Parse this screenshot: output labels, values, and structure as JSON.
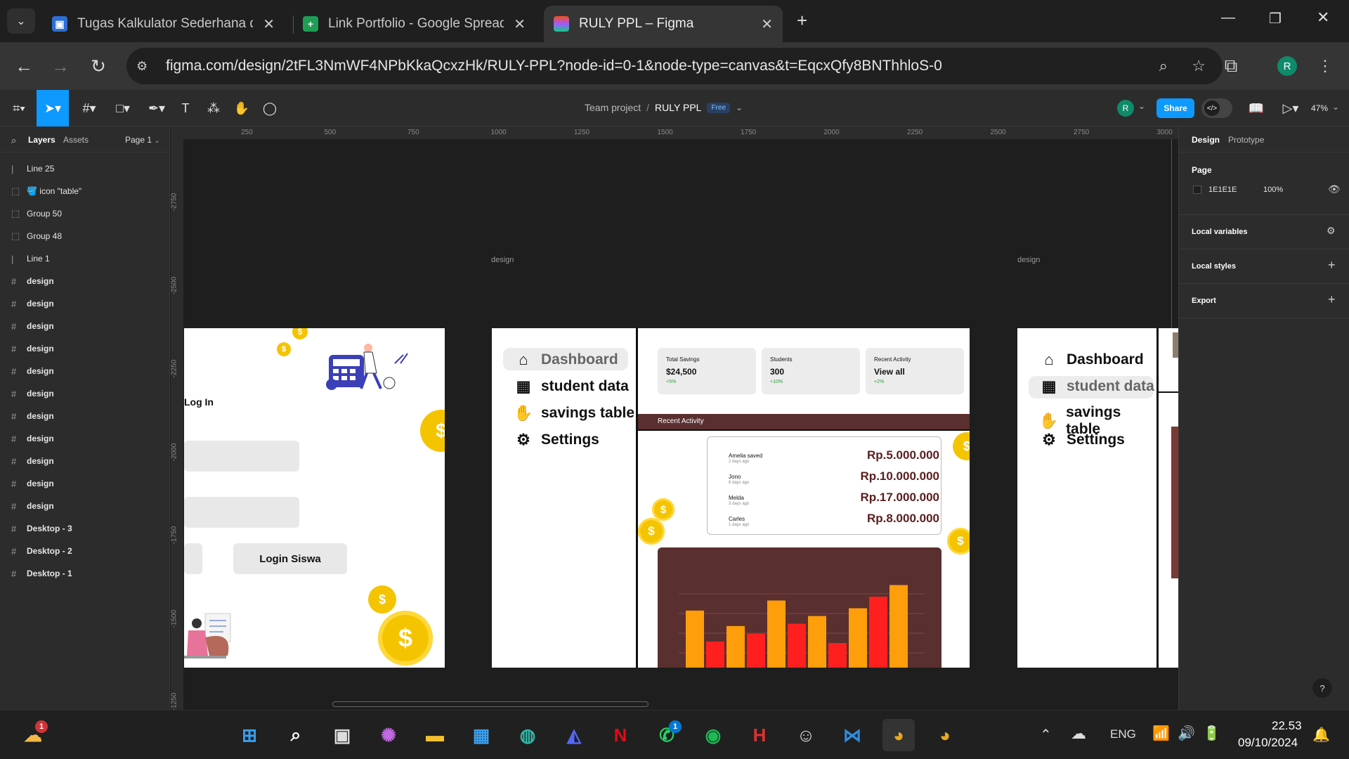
{
  "browser": {
    "tabs": [
      {
        "title": "Tugas Kalkulator Sederhana dengan",
        "active": false
      },
      {
        "title": "Link Portfolio - Google Spreadsheet",
        "active": false
      },
      {
        "title": "RULY PPL – Figma",
        "active": true
      }
    ],
    "url": "figma.com/design/2tFL3NmWF4NPbKkaQcxzHk/RULY-PPL?node-id=0-1&node-type=canvas&t=EqcxQfy8BNThhloS-0",
    "profile_initial": "R"
  },
  "figma_toolbar": {
    "breadcrumb_team": "Team project",
    "breadcrumb_sep": "/",
    "file_name": "RULY PPL",
    "plan_badge": "Free",
    "avatar_initial": "R",
    "share_label": "Share",
    "zoom": "47%"
  },
  "left_panel": {
    "tab_layers": "Layers",
    "tab_assets": "Assets",
    "page_selector": "Page 1",
    "layers": [
      {
        "icon": "line-icon",
        "glyph": "|",
        "name": "Line 25"
      },
      {
        "icon": "group-icon",
        "glyph": "⬚",
        "name": "🪣 icon \"table\""
      },
      {
        "icon": "group-icon",
        "glyph": "⬚",
        "name": "Group 50"
      },
      {
        "icon": "group-icon",
        "glyph": "⬚",
        "name": "Group 48"
      },
      {
        "icon": "line-icon",
        "glyph": "|",
        "name": "Line 1"
      },
      {
        "icon": "frame-icon",
        "glyph": "#",
        "name": "design"
      },
      {
        "icon": "frame-icon",
        "glyph": "#",
        "name": "design"
      },
      {
        "icon": "frame-icon",
        "glyph": "#",
        "name": "design"
      },
      {
        "icon": "frame-icon",
        "glyph": "#",
        "name": "design"
      },
      {
        "icon": "frame-icon",
        "glyph": "#",
        "name": "design"
      },
      {
        "icon": "frame-icon",
        "glyph": "#",
        "name": "design"
      },
      {
        "icon": "frame-icon",
        "glyph": "#",
        "name": "design"
      },
      {
        "icon": "frame-icon",
        "glyph": "#",
        "name": "design"
      },
      {
        "icon": "frame-icon",
        "glyph": "#",
        "name": "design"
      },
      {
        "icon": "frame-icon",
        "glyph": "#",
        "name": "design"
      },
      {
        "icon": "frame-icon",
        "glyph": "#",
        "name": "design"
      },
      {
        "icon": "frame-icon",
        "glyph": "#",
        "name": "Desktop - 3"
      },
      {
        "icon": "frame-icon",
        "glyph": "#",
        "name": "Desktop - 2"
      },
      {
        "icon": "frame-icon",
        "glyph": "#",
        "name": "Desktop - 1"
      }
    ]
  },
  "rulers": {
    "top": [
      "250",
      "500",
      "750",
      "1000",
      "1250",
      "1500",
      "1750",
      "2000",
      "2250",
      "2500",
      "2750",
      "3000"
    ],
    "left": [
      "-2750",
      "-2500",
      "-2250",
      "-2000",
      "-1750",
      "-1500",
      "-1250"
    ]
  },
  "canvas": {
    "frame_label_1": "design",
    "frame_label_2": "design",
    "login": {
      "title": "Log In",
      "button": "Login Siswa",
      "coin_symbol": "$"
    },
    "sidebar_a": {
      "items": [
        {
          "icon": "home-icon",
          "glyph": "⌂",
          "label": "Dashboard"
        },
        {
          "icon": "table-icon",
          "glyph": "▦",
          "label": "student data"
        },
        {
          "icon": "savings-icon",
          "glyph": "✋",
          "label": "savings table"
        },
        {
          "icon": "gear-icon",
          "glyph": "⚙",
          "label": "Settings"
        }
      ]
    },
    "dashboard": {
      "cards": [
        {
          "label": "Total Savings",
          "value": "$24,500",
          "change": "+5%"
        },
        {
          "label": "Students",
          "value": "300",
          "change": "+10%"
        },
        {
          "label": "Recent Activity",
          "value": "View all",
          "change": "+2%"
        }
      ],
      "recent_activity_title": "Recent Activity",
      "activity": [
        {
          "name": "Amelia saved",
          "ago": "2 days ago",
          "amount": "Rp.5.000.000"
        },
        {
          "name": "Jono",
          "ago": "6 days ago",
          "amount": "Rp.10.000.000"
        },
        {
          "name": "Melda",
          "ago": "3 days ago",
          "amount": "Rp.17.000.000"
        },
        {
          "name": "Carles",
          "ago": "1 days ago",
          "amount": "Rp.8.000.000"
        }
      ],
      "bars": [
        {
          "value": 0.82,
          "color": "#ff9e0b"
        },
        {
          "value": 0.42,
          "color": "#ff1f1f"
        },
        {
          "value": 0.62,
          "color": "#ff9e0b"
        },
        {
          "value": 0.52,
          "color": "#ff1f1f"
        },
        {
          "value": 0.95,
          "color": "#ff9e0b"
        },
        {
          "value": 0.65,
          "color": "#ff1f1f"
        },
        {
          "value": 0.75,
          "color": "#ff9e0b"
        },
        {
          "value": 0.4,
          "color": "#ff1f1f"
        },
        {
          "value": 0.85,
          "color": "#ff9e0b"
        },
        {
          "value": 1.0,
          "color": "#ff1f1f"
        },
        {
          "value": 1.15,
          "color": "#ff9e0b"
        }
      ]
    },
    "sidebar_b": {
      "items": [
        {
          "icon": "home-icon",
          "glyph": "⌂",
          "label": "Dashboard"
        },
        {
          "icon": "table-icon",
          "glyph": "▦",
          "label": "student data"
        },
        {
          "icon": "savings-icon",
          "glyph": "✋",
          "label": "savings table"
        },
        {
          "icon": "gear-icon",
          "glyph": "⚙",
          "label": "Settings"
        }
      ]
    }
  },
  "right_panel": {
    "tab_design": "Design",
    "tab_prototype": "Prototype",
    "page_heading": "Page",
    "page_color": "1E1E1E",
    "page_opacity": "100%",
    "local_variables": "Local variables",
    "local_styles": "Local styles",
    "export": "Export",
    "help": "?"
  },
  "taskbar": {
    "weather_badge": "1",
    "whatsapp_badge": "1",
    "lang": "ENG",
    "time": "22.53",
    "date": "09/10/2024"
  },
  "colors": {
    "figma_blue": "#0d99ff",
    "brown": "#5a2f2f",
    "coin": "#f5c400"
  }
}
